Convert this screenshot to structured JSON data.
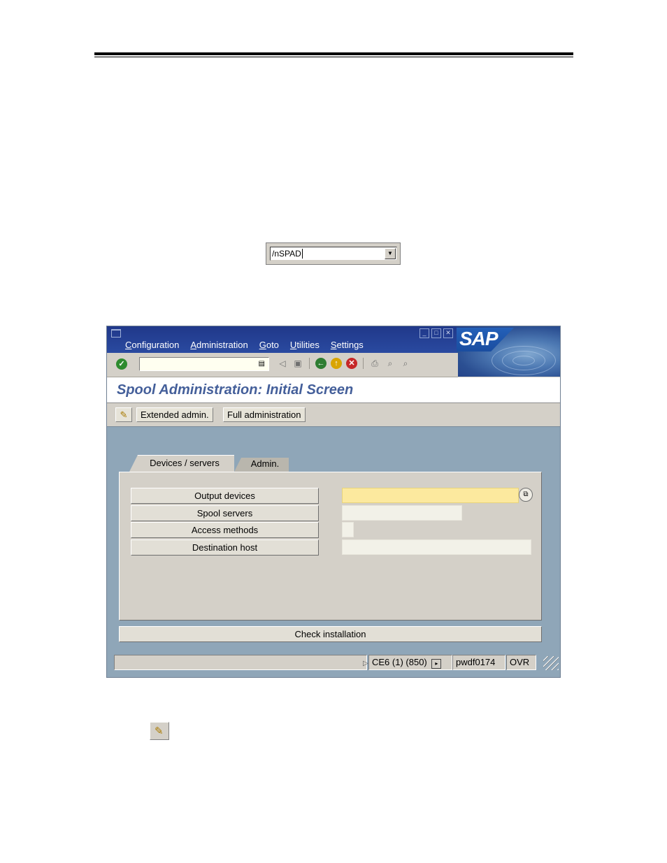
{
  "command_snippet": {
    "value": "/nSPAD"
  },
  "sap": {
    "menu": [
      {
        "underline": "C",
        "rest": "onfiguration"
      },
      {
        "underline": "A",
        "rest": "dministration"
      },
      {
        "underline": "G",
        "rest": "oto"
      },
      {
        "underline": "U",
        "rest": "tilities"
      },
      {
        "underline": "S",
        "rest": "ettings"
      }
    ],
    "logo_text": "SAP",
    "command_field_value": "",
    "screen_title": "Spool Administration: Initial Screen",
    "app_toolbar": {
      "extended_admin": "Extended admin.",
      "full_admin": "Full administration"
    },
    "tabs": {
      "devices_servers": "Devices / servers",
      "admin": "Admin."
    },
    "panel_buttons": {
      "output_devices": "Output devices",
      "spool_servers": "Spool servers",
      "access_methods": "Access methods",
      "destination_host": "Destination host"
    },
    "check_installation": "Check installation",
    "status": {
      "system": "CE6 (1) (850)",
      "server": "pwdf0174",
      "mode": "OVR"
    }
  },
  "icons": {
    "ok": "green-check-icon",
    "edit": "pencil-icon"
  }
}
